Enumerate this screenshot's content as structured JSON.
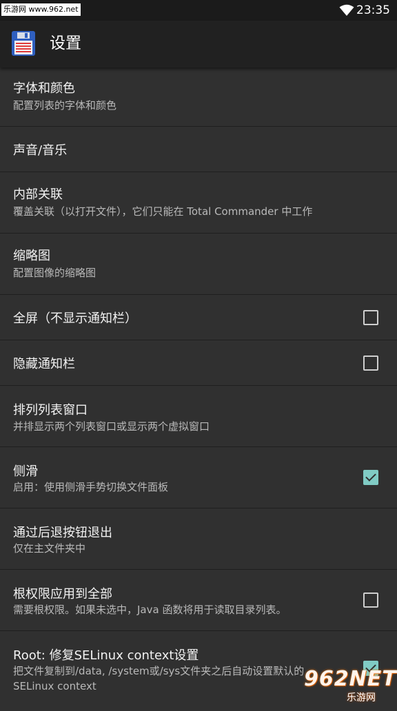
{
  "status_bar": {
    "watermark": "乐游网 www.962.net",
    "time": "23:35",
    "wifi_icon": "wifi-icon"
  },
  "app_bar": {
    "icon": "floppy-disk-icon",
    "title": "设置"
  },
  "settings": [
    {
      "title": "字体和颜色",
      "subtitle": "配置列表的字体和颜色",
      "checkbox": null
    },
    {
      "title": "声音/音乐",
      "subtitle": "",
      "checkbox": null
    },
    {
      "title": "内部关联",
      "subtitle": "覆盖关联（以打开文件），它们只能在 Total Commander 中工作",
      "checkbox": null
    },
    {
      "title": "缩略图",
      "subtitle": "配置图像的缩略图",
      "checkbox": null
    },
    {
      "title": "全屏（不显示通知栏）",
      "subtitle": "",
      "checkbox": false
    },
    {
      "title": "隐藏通知栏",
      "subtitle": "",
      "checkbox": false
    },
    {
      "title": "排列列表窗口",
      "subtitle": "并排显示两个列表窗口或显示两个虚拟窗口",
      "checkbox": null
    },
    {
      "title": "侧滑",
      "subtitle": "启用：使用侧滑手势切换文件面板",
      "checkbox": true
    },
    {
      "title": "通过后退按钮退出",
      "subtitle": "仅在主文件夹中",
      "checkbox": null
    },
    {
      "title": "根权限应用到全部",
      "subtitle": "需要根权限。如果未选中，Java 函数将用于读取目录列表。",
      "checkbox": false
    },
    {
      "title": "Root: 修复SELinux context设置",
      "subtitle": "把文件复制到/data, /system或/sys文件夹之后自动设置默认的 SELinux context",
      "checkbox": true
    }
  ],
  "watermark_bottom": {
    "big": "962NET",
    "small": "乐游网"
  },
  "colors": {
    "background": "#303030",
    "app_bar": "#212121",
    "accent": "#80cbc4"
  }
}
